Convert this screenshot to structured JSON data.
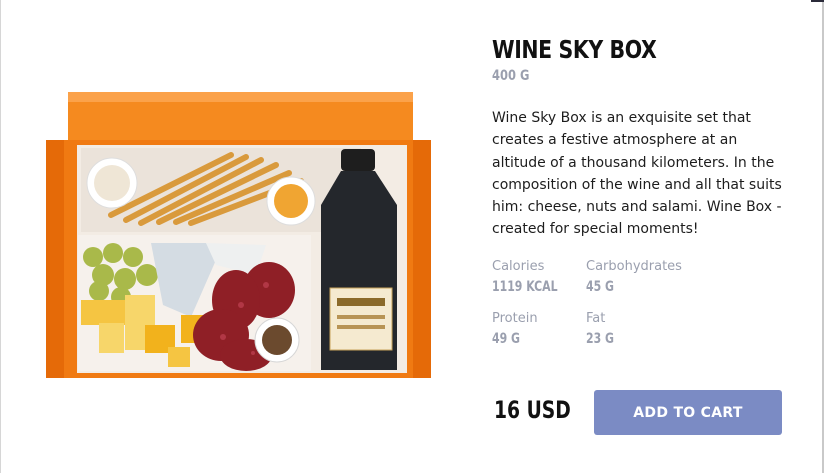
{
  "product": {
    "name": "WINE SKY BOX",
    "weight": "400 G",
    "description": "Wine Sky Box is an exquisite set that creates a festive atmosphere at an altitude of a thousand kilometers. In the composition of the wine and all that suits him: cheese, nuts and salami. Wine Box - created for special moments!",
    "image_icon": "product-photo-icon"
  },
  "nutrition": {
    "calories": {
      "label": "Calories",
      "value": "1119 KCAL"
    },
    "carbohydrates": {
      "label": "Carbohydrates",
      "value": "45 G"
    },
    "protein": {
      "label": "Protein",
      "value": "49 G"
    },
    "fat": {
      "label": "Fat",
      "value": "23 G"
    }
  },
  "purchase": {
    "price": "16 USD",
    "cart_label": "ADD TO CART"
  },
  "colors": {
    "accent": "#7b8bc4",
    "muted_text": "#9a9fae",
    "box_orange": "#f07a12"
  }
}
